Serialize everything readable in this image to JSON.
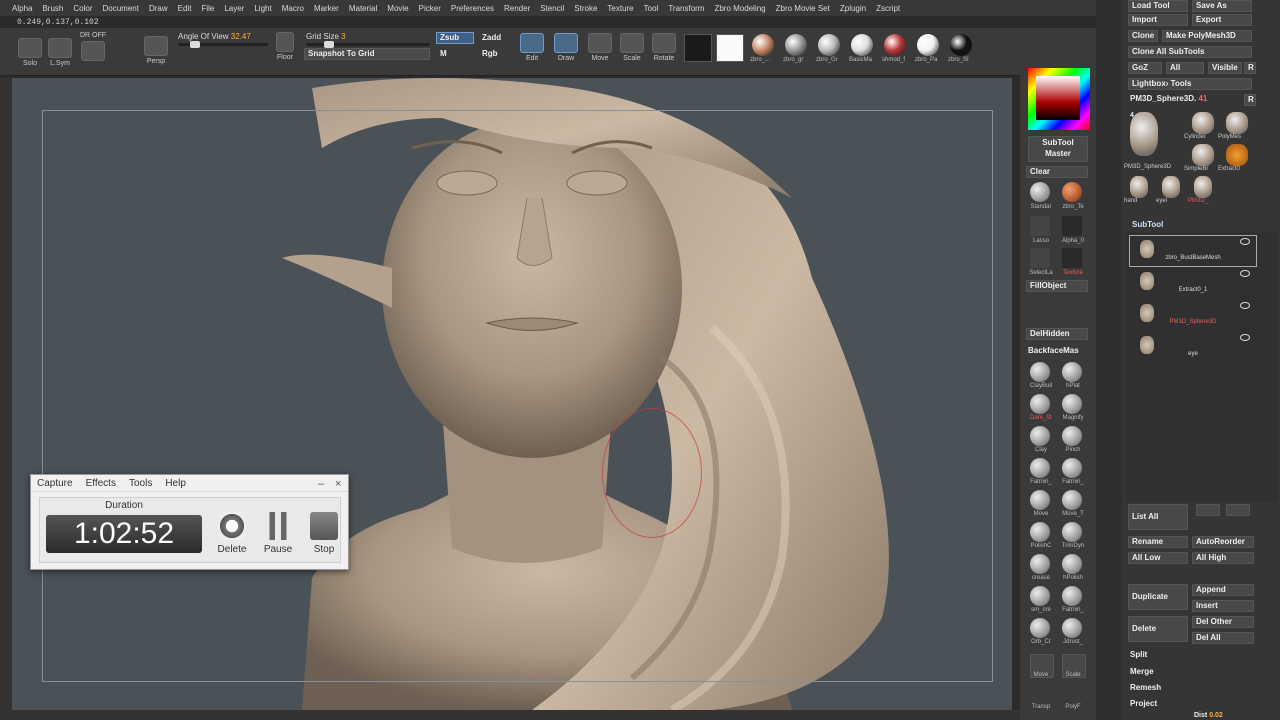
{
  "menu": [
    "Alpha",
    "Brush",
    "Color",
    "Document",
    "Draw",
    "Edit",
    "File",
    "Layer",
    "Light",
    "Macro",
    "Marker",
    "Material",
    "Movie",
    "Picker",
    "Preferences",
    "Render",
    "Stencil",
    "Stroke",
    "Texture",
    "Tool",
    "Transform",
    "Zbro Modeling",
    "Zbro Movie Set",
    "Zplugin",
    "Zscript"
  ],
  "coords": "0.249,0.137,0.102",
  "toolbar": {
    "solo": "Solo",
    "lsym": "L.Sym",
    "dynamic": "DR OFF",
    "persp": "Persp",
    "angle_label": "Angle Of View",
    "angle_value": "32.47",
    "floor": "Floor",
    "grid_label": "Grid Size",
    "grid_value": "3",
    "snapshot": "Snapshot To Grid",
    "zsub": "Zsub",
    "zadd": "Zadd",
    "m": "M",
    "rgb": "Rgb",
    "edit": "Edit",
    "draw": "Draw",
    "move": "Move",
    "scale": "Scale",
    "rotate": "Rotate",
    "materials": [
      {
        "label": "zbro_...",
        "color": "#c88a6a"
      },
      {
        "label": "zbro_gr",
        "color": "#9a9a9a"
      },
      {
        "label": "zbro_Gr",
        "color": "#bbbbbb"
      },
      {
        "label": "BasicMa",
        "color": "#dddddd"
      },
      {
        "label": "shmod_f",
        "color": "#b83a3a"
      },
      {
        "label": "zbro_Pa",
        "color": "#f2f2f2"
      },
      {
        "label": "zbro_SI",
        "color": "#111111"
      }
    ]
  },
  "recorder": {
    "menu": [
      "Capture",
      "Effects",
      "Tools",
      "Help"
    ],
    "minimize": "–",
    "close": "×",
    "duration_label": "Duration",
    "time": "1:02:52",
    "delete": "Delete",
    "pause": "Pause",
    "stop": "Stop"
  },
  "midpanel": {
    "subtool_master": "SubTool Master",
    "clear": "Clear",
    "standard": "Standar",
    "zbro_te": "zbro_Te",
    "lasso": "Lasso",
    "alpha": "Alpha_0",
    "select": "SelectLa",
    "texture": "Texture",
    "fill_object": "FillObject",
    "del_hidden": "DelHidden",
    "backface": "BackfaceMas",
    "brushes": [
      [
        "ClayBuil",
        "hPlat"
      ],
      [
        "Dam_St",
        "Magnify"
      ],
      [
        "Clay",
        "Pinch"
      ],
      [
        "Fatmiri_",
        "Fatmiri_"
      ],
      [
        "Move",
        "Move_T"
      ],
      [
        "PolishC",
        "TrimDyn"
      ],
      [
        "crease",
        "hPolish"
      ],
      [
        "sm_cre",
        "Fatmiri_"
      ],
      [
        "Orb_Cr",
        "Jdrust_"
      ]
    ],
    "move": "Move",
    "scale": "Scale",
    "transp": "Transp",
    "polyf": "PolyF"
  },
  "rightpanel": {
    "load_tool": "Load Tool",
    "save_as": "Save As",
    "import": "Import",
    "export": "Export",
    "clone": "Clone",
    "make_polymesh": "Make PolyMesh3D",
    "clone_all": "Clone All SubTools",
    "goz": "GoZ",
    "all": "All",
    "visible": "Visible",
    "r": "R",
    "lightbox_tools": "Lightbox› Tools",
    "current_tool": "PM3D_Sphere3D.",
    "current_tool_num": "41",
    "tool_count": "4",
    "tools": [
      "PM3D_Sphere3D",
      "Cylinder",
      "PolyMes",
      "SimpleBr",
      "Extract0",
      "hand",
      "eyel",
      "PM3D_"
    ],
    "subtool_header": "SubTool",
    "subtools": [
      "zbro_BustBaseMesh",
      "Extract0_1",
      "PM3D_Sphere3D",
      "eye"
    ],
    "list_all": "List All",
    "rename": "Rename",
    "auto_reorder": "AutoReorder",
    "all_low": "All Low",
    "all_high": "All High",
    "duplicate": "Duplicate",
    "append": "Append",
    "insert": "Insert",
    "delete": "Delete",
    "del_other": "Del Other",
    "del_all": "Del All",
    "split": "Split",
    "merge": "Merge",
    "remesh": "Remesh",
    "project": "Project",
    "dist": "Dist",
    "dist_value": "0.02"
  }
}
